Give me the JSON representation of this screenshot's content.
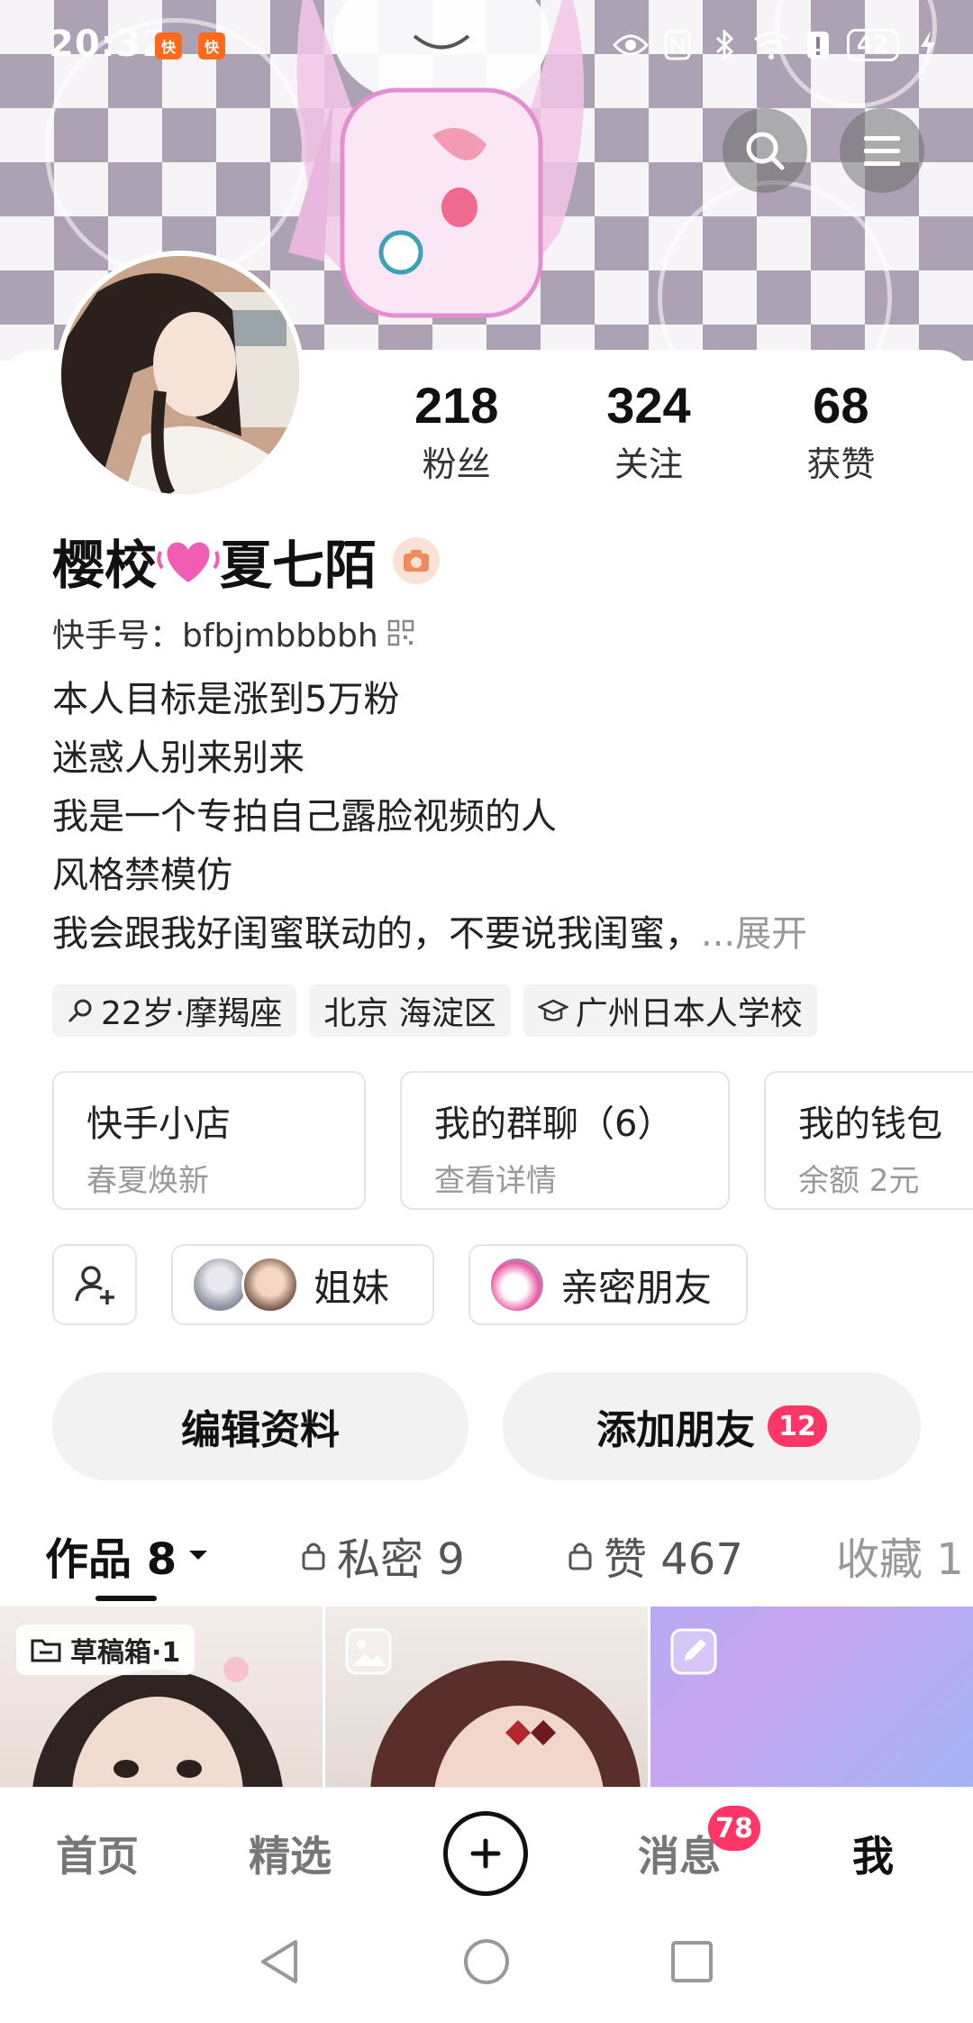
{
  "status_bar": {
    "time": "20:32",
    "battery": "42",
    "app_badges": [
      "快",
      "快"
    ]
  },
  "header": {
    "search_icon": "search-icon",
    "menu_icon": "menu-icon"
  },
  "profile": {
    "stats": [
      {
        "value": "218",
        "label": "粉丝"
      },
      {
        "value": "324",
        "label": "关注"
      },
      {
        "value": "68",
        "label": "获赞"
      }
    ],
    "name_part1": "樱校",
    "name_part2": "夏七陌",
    "kuaishou_id": "快手号：bfbjmbbbbh",
    "bio_lines": [
      "本人目标是涨到5万粉",
      "迷惑人别来别来",
      "我是一个专拍自己露脸视频的人",
      "风格禁模仿",
      "我会跟我好闺蜜联动的，不要说我闺蜜，"
    ],
    "bio_more": "...展开",
    "tags": [
      "22岁·摩羯座",
      "北京 海淀区",
      "广州日本人学校"
    ]
  },
  "features": [
    {
      "title": "快手小店",
      "subtitle": "春夏焕新"
    },
    {
      "title": "我的群聊（6）",
      "subtitle": "查看详情"
    },
    {
      "title": "我的钱包",
      "subtitle": "余额 2元"
    }
  ],
  "relations": {
    "sisters_label": "姐妹",
    "close_friends_label": "亲密朋友"
  },
  "actions": {
    "edit_profile": "编辑资料",
    "add_friend": "添加朋友",
    "add_friend_count": "12"
  },
  "tabs": {
    "works": "作品 8",
    "private": "私密 9",
    "likes": "赞 467",
    "collections": "收藏 1"
  },
  "grid": {
    "draft_label": "草稿箱·1"
  },
  "bottom_nav": {
    "home": "首页",
    "featured": "精选",
    "messages": "消息",
    "messages_badge": "78",
    "me": "我"
  },
  "colors": {
    "accent_red": "#fe3666",
    "banner_purple": "#8e7d97"
  }
}
